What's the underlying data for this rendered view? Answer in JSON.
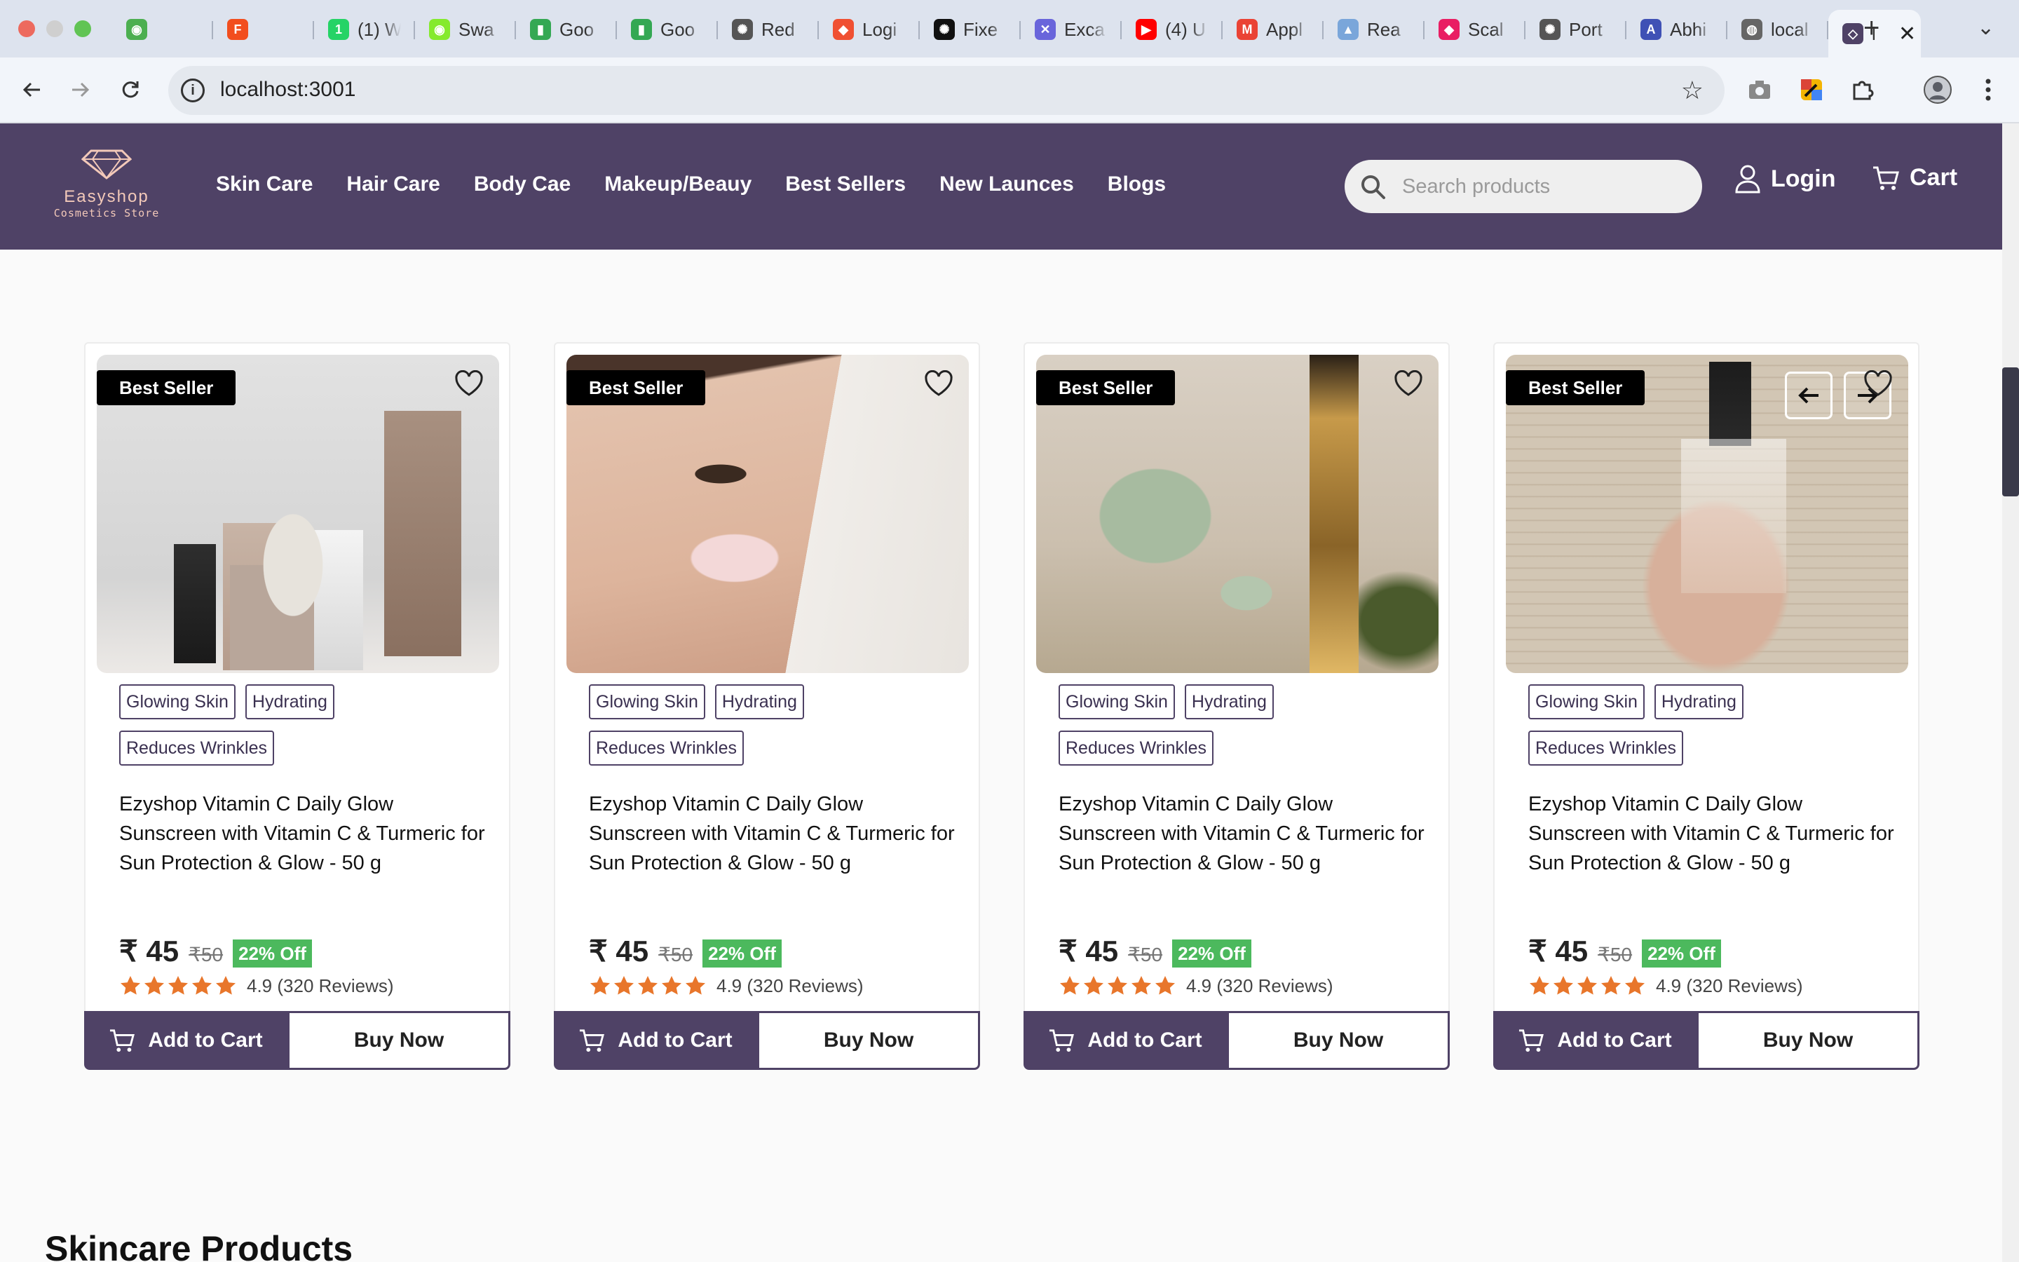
{
  "browser": {
    "tabs": [
      {
        "title": "",
        "color": "#4caf50",
        "glyph": "◉"
      },
      {
        "title": "",
        "color": "#f24e1e",
        "glyph": "F"
      },
      {
        "title": "(1) W",
        "color": "#25d366",
        "glyph": "1"
      },
      {
        "title": "Swa",
        "color": "#85ea2d",
        "glyph": "◉"
      },
      {
        "title": "Goo",
        "color": "#34a853",
        "glyph": "▮"
      },
      {
        "title": "Goo",
        "color": "#34a853",
        "glyph": "▮"
      },
      {
        "title": "Red",
        "color": "#555555",
        "glyph": "✺"
      },
      {
        "title": "Logi",
        "color": "#f05032",
        "glyph": "◆"
      },
      {
        "title": "Fixe",
        "color": "#111111",
        "glyph": "✺"
      },
      {
        "title": "Exca",
        "color": "#6965db",
        "glyph": "✕"
      },
      {
        "title": "(4) U",
        "color": "#ff0000",
        "glyph": "▶"
      },
      {
        "title": "Appl",
        "color": "#ea4335",
        "glyph": "M"
      },
      {
        "title": "Rea",
        "color": "#7aa6da",
        "glyph": "▲"
      },
      {
        "title": "Scal",
        "color": "#e91e63",
        "glyph": "◆"
      },
      {
        "title": "Port",
        "color": "#555555",
        "glyph": "✺"
      },
      {
        "title": "Abhi",
        "color": "#3f51b5",
        "glyph": "A"
      },
      {
        "title": "local",
        "color": "#666666",
        "glyph": "◍"
      }
    ],
    "active_tab": {
      "title": "l",
      "color": "#4f4266",
      "glyph": "◇"
    },
    "url": "localhost:3001"
  },
  "header": {
    "logo_name": "Easyshop",
    "logo_sub": "Cosmetics Store",
    "nav": [
      "Skin Care",
      "Hair Care",
      "Body Cae",
      "Makeup/Beauy",
      "Best Sellers",
      "New Launces",
      "Blogs"
    ],
    "search_placeholder": "Search products",
    "login_label": "Login",
    "cart_label": "Cart"
  },
  "products": [
    {
      "badge": "Best Seller",
      "tags": [
        "Glowing Skin",
        "Hydrating",
        "Reduces Wrinkles"
      ],
      "title": "Ezyshop Vitamin C Daily Glow Sunscreen with Vitamin C & Turmeric for Sun Protection & Glow - 50 g",
      "price": "₹ 45",
      "mrp": "₹50",
      "discount": "22% Off",
      "rating": "4.9",
      "reviews": "(320 Reviews)",
      "stars": 5,
      "add_to_cart": "Add to Cart",
      "buy_now": "Buy Now"
    },
    {
      "badge": "Best Seller",
      "tags": [
        "Glowing Skin",
        "Hydrating",
        "Reduces Wrinkles"
      ],
      "title": "Ezyshop Vitamin C Daily Glow Sunscreen with Vitamin C & Turmeric for Sun Protection & Glow - 50 g",
      "price": "₹ 45",
      "mrp": "₹50",
      "discount": "22% Off",
      "rating": "4.9",
      "reviews": "(320 Reviews)",
      "stars": 5,
      "add_to_cart": "Add to Cart",
      "buy_now": "Buy Now"
    },
    {
      "badge": "Best Seller",
      "tags": [
        "Glowing Skin",
        "Hydrating",
        "Reduces Wrinkles"
      ],
      "title": "Ezyshop Vitamin C Daily Glow Sunscreen with Vitamin C & Turmeric for Sun Protection & Glow - 50 g",
      "price": "₹ 45",
      "mrp": "₹50",
      "discount": "22% Off",
      "rating": "4.9",
      "reviews": "(320 Reviews)",
      "stars": 5,
      "add_to_cart": "Add to Cart",
      "buy_now": "Buy Now"
    },
    {
      "badge": "Best Seller",
      "tags": [
        "Glowing Skin",
        "Hydrating",
        "Reduces Wrinkles"
      ],
      "title": "Ezyshop Vitamin C Daily Glow Sunscreen with Vitamin C & Turmeric for Sun Protection & Glow - 50 g",
      "price": "₹ 45",
      "mrp": "₹50",
      "discount": "22% Off",
      "rating": "4.9",
      "reviews": "(320 Reviews)",
      "stars": 5,
      "add_to_cart": "Add to Cart",
      "buy_now": "Buy Now"
    }
  ],
  "section_heading": "Skincare Products",
  "colors": {
    "brand": "#4f4266",
    "logo": "#f3c9b9",
    "discount": "#4cb95d",
    "star": "#e8762b"
  },
  "icons": {
    "carousel_prev": "arrow-left-icon",
    "carousel_next": "arrow-right-icon",
    "wishlist": "heart-icon",
    "cart": "cart-icon",
    "user": "user-icon",
    "search": "search-icon"
  }
}
